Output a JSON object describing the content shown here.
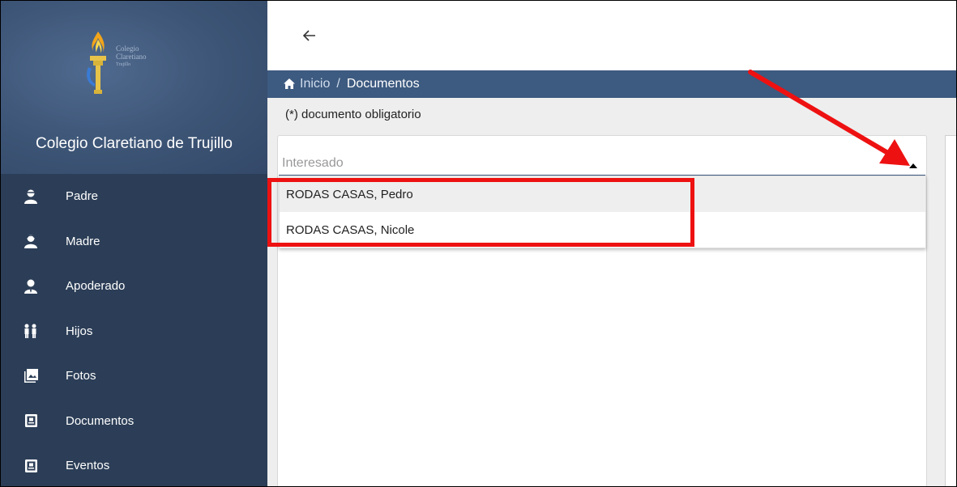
{
  "sidebar": {
    "logo_text": [
      "Colegio",
      "Claretiano",
      "Trujillo"
    ],
    "school_name": "Colegio Claretiano de Trujillo",
    "items": [
      {
        "label": "Padre",
        "icon": "user-icon"
      },
      {
        "label": "Madre",
        "icon": "user-female-icon"
      },
      {
        "label": "Apoderado",
        "icon": "user-tie-icon"
      },
      {
        "label": "Hijos",
        "icon": "children-icon"
      },
      {
        "label": "Fotos",
        "icon": "photos-icon"
      },
      {
        "label": "Documentos",
        "icon": "document-icon"
      },
      {
        "label": "Eventos",
        "icon": "calendar-doc-icon"
      }
    ]
  },
  "header": {
    "back_icon": "arrow-left-icon"
  },
  "breadcrumb": {
    "home": "Inicio",
    "separator": "/",
    "current": "Documentos"
  },
  "note": "(*) documento obligatorio",
  "select": {
    "placeholder": "Interesado",
    "options": [
      "RODAS CASAS, Pedro",
      "RODAS CASAS, Nicole"
    ]
  },
  "colors": {
    "sidebar": "#2c3e57",
    "breadcrumb_bar": "#3d5a80",
    "highlight": "#ee1111"
  }
}
